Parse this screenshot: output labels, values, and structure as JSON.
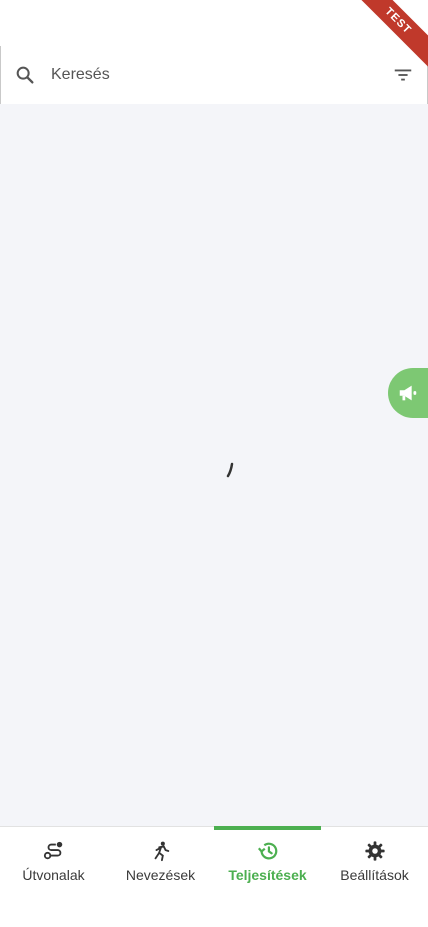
{
  "ribbon": {
    "label": "TEST",
    "color": "#c0392b"
  },
  "search": {
    "placeholder": "Keresés",
    "value": "",
    "search_icon": "search-icon",
    "filter_icon": "filter-icon"
  },
  "content": {
    "state": "loading",
    "background": "#f4f5f9"
  },
  "side_button": {
    "icon": "megaphone-icon",
    "color": "#7dc873"
  },
  "bottom_nav": {
    "accent": "#4caf50",
    "active_index": 2,
    "items": [
      {
        "label": "Útvonalak",
        "icon": "route-icon"
      },
      {
        "label": "Nevezések",
        "icon": "run-icon"
      },
      {
        "label": "Teljesítések",
        "icon": "history-icon"
      },
      {
        "label": "Beállítások",
        "icon": "gear-icon"
      }
    ]
  }
}
